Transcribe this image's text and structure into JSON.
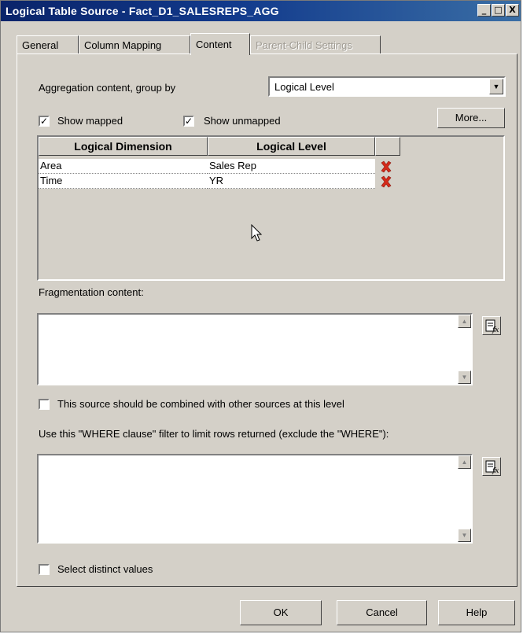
{
  "window": {
    "title": "Logical Table Source - Fact_D1_SALESREPS_AGG",
    "minimize_label": "_",
    "maximize_label": "□",
    "close_label": "X"
  },
  "tabs": [
    {
      "label": "General"
    },
    {
      "label": "Column Mapping"
    },
    {
      "label": "Content"
    },
    {
      "label": "Parent-Child Settings"
    }
  ],
  "content": {
    "aggregation_label": "Aggregation content, group by",
    "aggregation_value": "Logical Level",
    "show_mapped": {
      "label": "Show mapped",
      "checked": true
    },
    "show_unmapped": {
      "label": "Show unmapped",
      "checked": true
    },
    "more_button": "More...",
    "grid": {
      "columns": [
        "Logical Dimension",
        "Logical Level"
      ],
      "rows": [
        {
          "dimension": "Area",
          "level": "Sales Rep"
        },
        {
          "dimension": "Time",
          "level": "YR"
        }
      ]
    },
    "fragmentation_label": "Fragmentation content:",
    "combine_checkbox": {
      "label": "This source should be combined with other sources at this level",
      "checked": false
    },
    "where_label": "Use this \"WHERE clause\" filter to limit rows returned (exclude the \"WHERE\"):",
    "distinct_checkbox": {
      "label": "Select distinct values",
      "checked": false
    }
  },
  "buttons": {
    "ok": "OK",
    "cancel": "Cancel",
    "help": "Help"
  },
  "colors": {
    "dialog_bg": "#d4d0c8",
    "title_bar": "#0a246a",
    "delete_icon": "#d42a1a"
  }
}
